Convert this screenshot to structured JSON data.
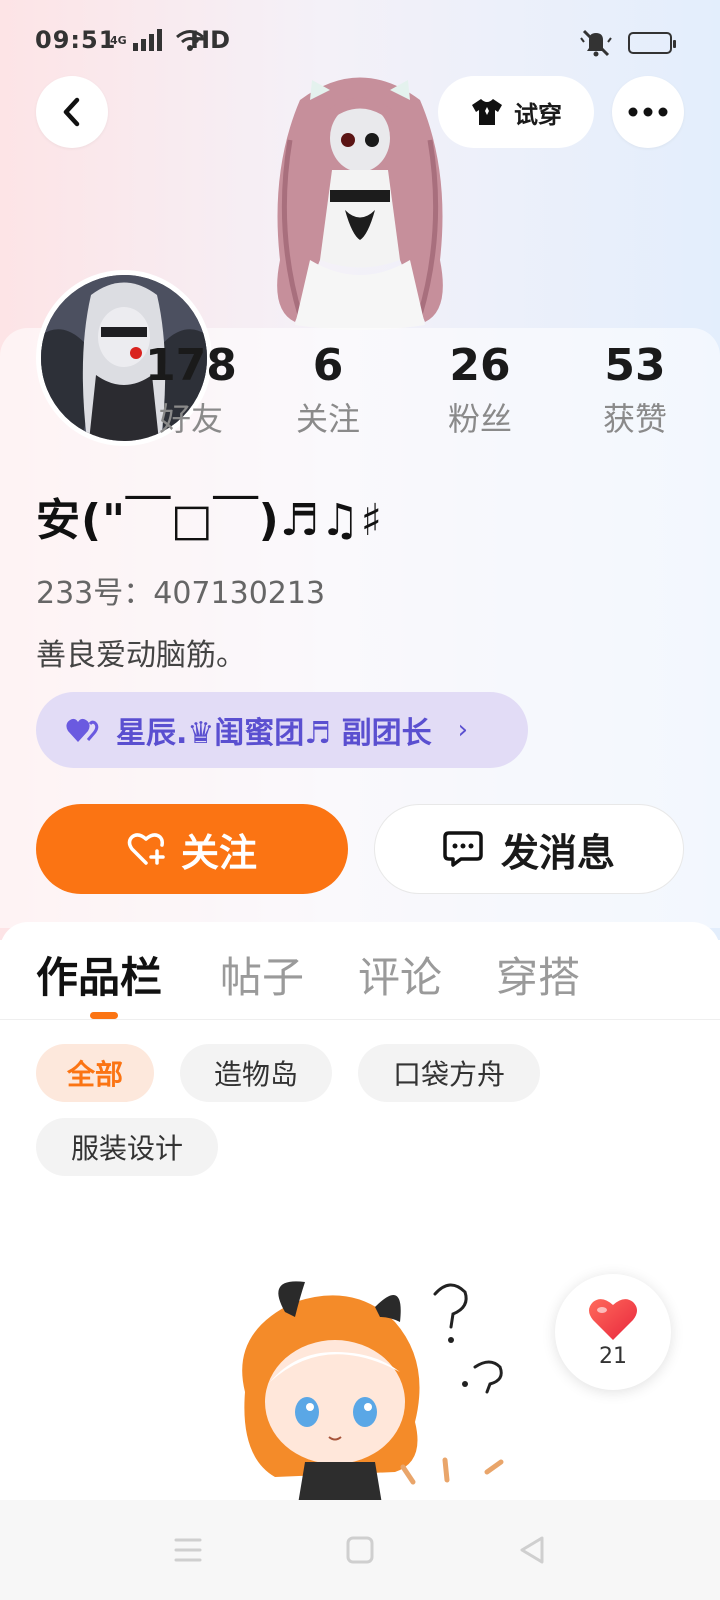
{
  "status_bar": {
    "time": "09:51",
    "network_type": "4G",
    "hd_label": "HD",
    "battery_level": 0.3,
    "battery_color": "#f5c518"
  },
  "header": {
    "back_icon": "chevron-left-icon",
    "tryon_label": "试穿",
    "tryon_icon": "shirt-icon",
    "more_icon": "more-dots-icon"
  },
  "profile": {
    "stats": [
      {
        "value": "178",
        "label": "好友"
      },
      {
        "value": "6",
        "label": "关注"
      },
      {
        "value": "26",
        "label": "粉丝"
      },
      {
        "value": "53",
        "label": "获赞"
      }
    ],
    "nickname": "安(\"￣□￣)♬♫♯",
    "uid": "233号：407130213",
    "bio": "善良爱动脑筋。",
    "group_badge": {
      "text": "星辰.♛闺蜜团♬ 副团长",
      "icon": "hearts-icon",
      "color": "#5a4fd0",
      "background": "#e2dcf6"
    }
  },
  "actions": {
    "follow_label": "关注",
    "follow_color": "#fb7413",
    "message_label": "发消息"
  },
  "tabs": [
    {
      "label": "作品栏",
      "active": true
    },
    {
      "label": "帖子",
      "active": false
    },
    {
      "label": "评论",
      "active": false
    },
    {
      "label": "穿搭",
      "active": false
    }
  ],
  "filters": [
    {
      "label": "全部",
      "active": true
    },
    {
      "label": "造物岛",
      "active": false
    },
    {
      "label": "口袋方舟",
      "active": false
    },
    {
      "label": "服装设计",
      "active": false
    }
  ],
  "like_float": {
    "count": "21",
    "icon": "heart-icon",
    "color": "#f0433a"
  },
  "nav": {
    "items": [
      "menu-icon",
      "home-square-icon",
      "back-triangle-icon"
    ]
  }
}
